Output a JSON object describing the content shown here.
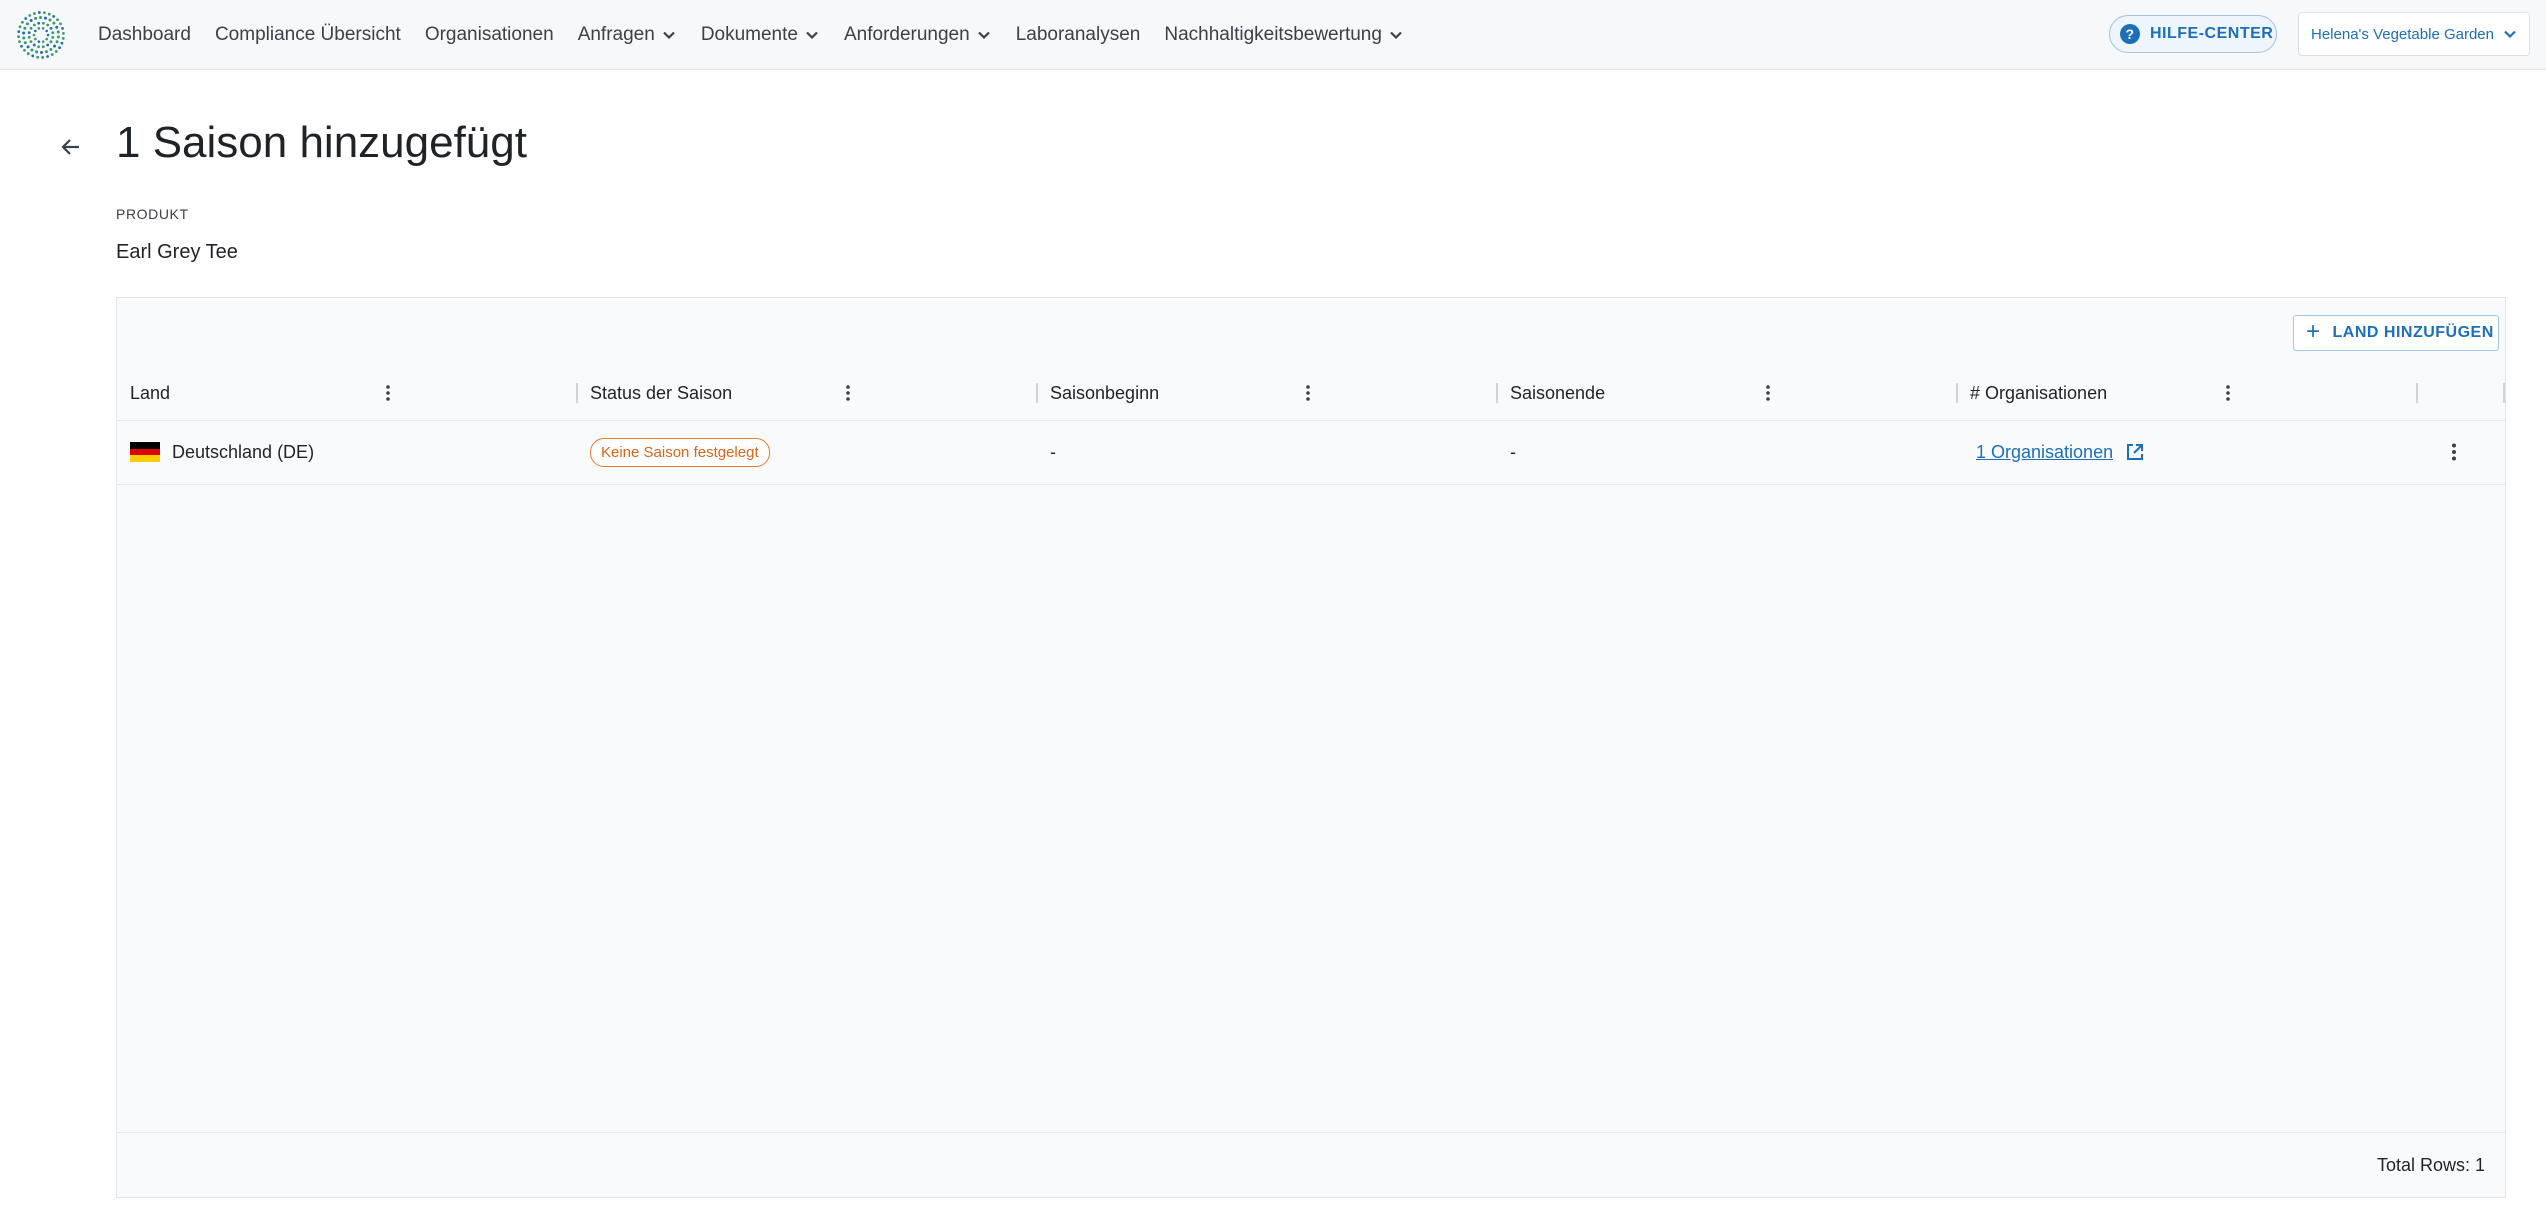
{
  "colors": {
    "accent": "#1d6fb8",
    "status_orange": "#e87b2a",
    "logo_green": "#3a9a6a",
    "logo_blue": "#1d6fb8"
  },
  "nav": {
    "logo_icon": "sunburst-logo-icon",
    "items": [
      {
        "label": "Dashboard",
        "dropdown": false
      },
      {
        "label": "Compliance Übersicht",
        "dropdown": false
      },
      {
        "label": "Organisationen",
        "dropdown": false
      },
      {
        "label": "Anfragen",
        "dropdown": true
      },
      {
        "label": "Dokumente",
        "dropdown": true
      },
      {
        "label": "Anforderungen",
        "dropdown": true
      },
      {
        "label": "Laboranalysen",
        "dropdown": false
      },
      {
        "label": "Nachhaltigkeitsbewertung",
        "dropdown": true
      }
    ],
    "help_label": "HILFE-CENTER",
    "help_icon": "question-circle-icon",
    "org_selector": "Helena's Vegetable Garden"
  },
  "page": {
    "title": "1 Saison hinzugefügt",
    "product_label": "PRODUKT",
    "product_value": "Earl Grey Tee"
  },
  "grid": {
    "add_button": "LAND HINZUFÜGEN",
    "columns": [
      "Land",
      "Status der Saison",
      "Saisonbeginn",
      "Saisonende",
      "# Organisationen"
    ],
    "rows": [
      {
        "country": "Deutschland (DE)",
        "flag_colors": [
          "#000000",
          "#dd0000",
          "#ffce00"
        ],
        "status": "Keine Saison festgelegt",
        "season_start": "-",
        "season_end": "-",
        "organisations": "1 Organisationen"
      }
    ],
    "total_rows": "Total Rows: 1"
  }
}
